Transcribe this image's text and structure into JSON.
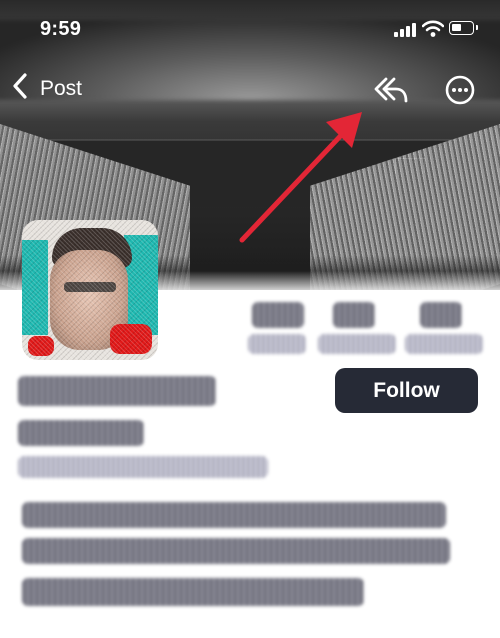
{
  "status_bar": {
    "time": "9:59"
  },
  "nav": {
    "back_label": "Post"
  },
  "profile": {
    "follow_label": "Follow"
  },
  "icons": {
    "back": "chevron-left-icon",
    "reply": "reply-arrow-icon",
    "more": "more-circle-icon"
  },
  "colors": {
    "follow_bg": "#262a36",
    "annotation_arrow": "#e32636"
  }
}
